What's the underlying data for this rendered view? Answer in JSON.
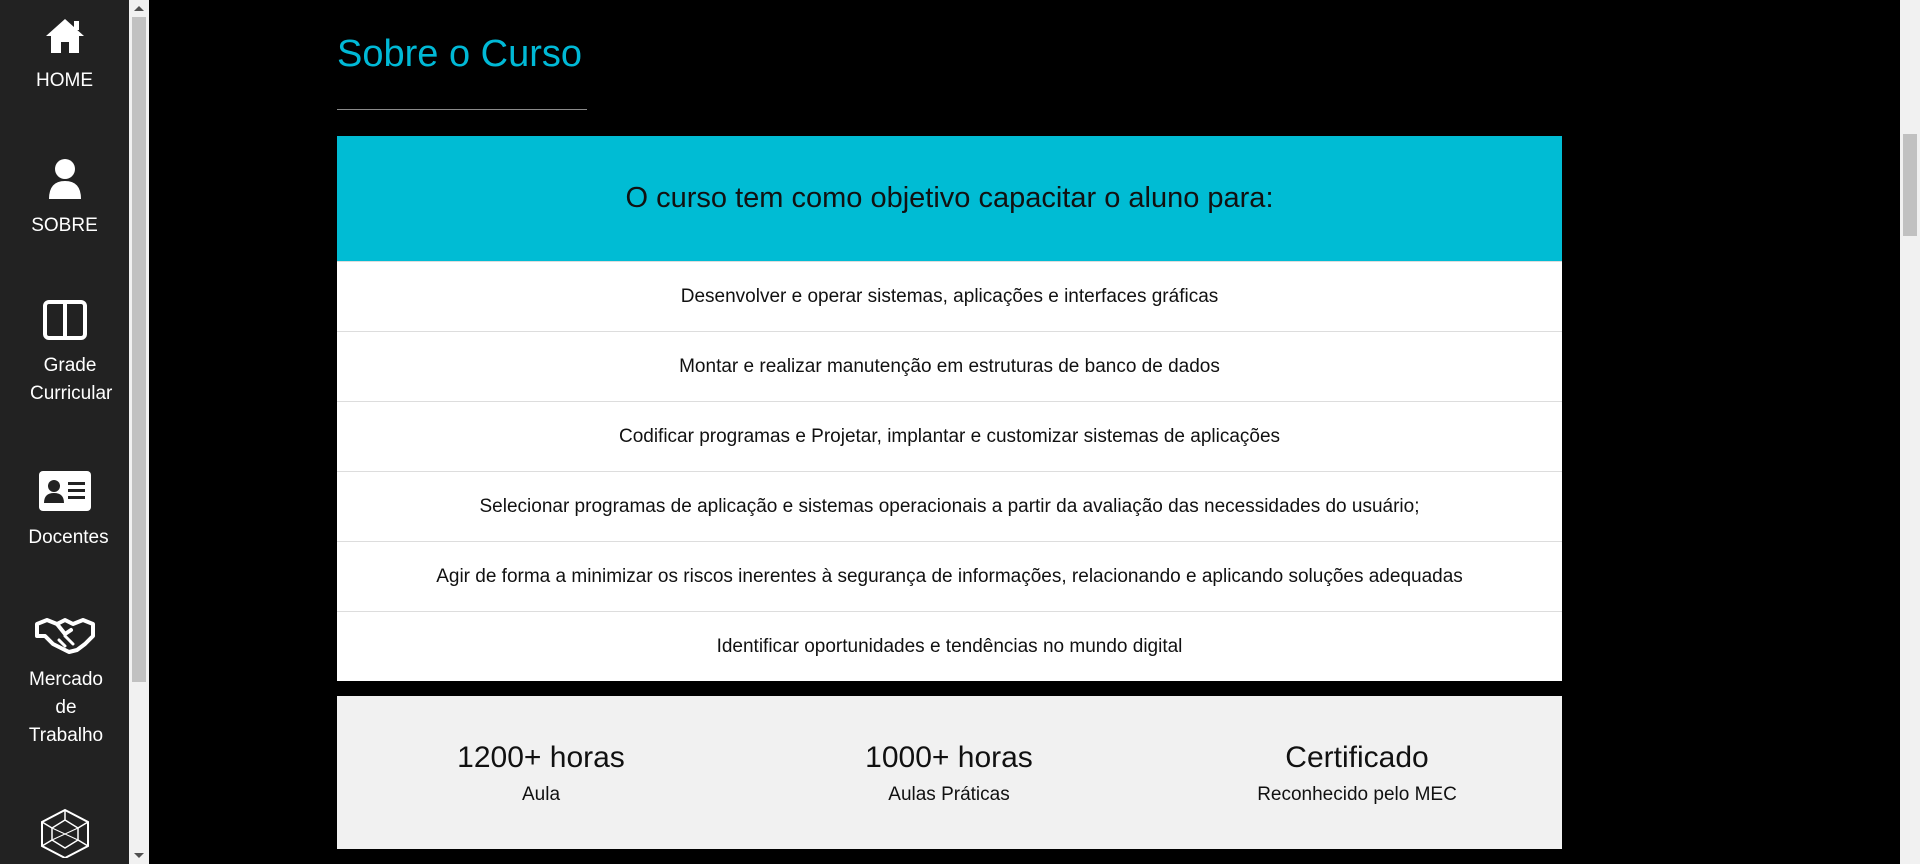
{
  "sidebar": {
    "items": [
      {
        "icon": "home-icon",
        "label": "HOME"
      },
      {
        "icon": "user-icon",
        "label": "SOBRE"
      },
      {
        "icon": "columns-icon",
        "label": "Grade Curricular"
      },
      {
        "icon": "id-card-icon",
        "label": "Docentes"
      },
      {
        "icon": "handshake-icon",
        "label": "Mercado de Trabalho"
      },
      {
        "icon": "polyhedron-icon",
        "label": ""
      }
    ]
  },
  "main": {
    "title": "Sobre o Curso",
    "objectives": {
      "heading": "O curso tem como objetivo capacitar o aluno para:",
      "items": [
        "Desenvolver e operar sistemas, aplicações e interfaces gráficas",
        "Montar e realizar manutenção em estruturas de banco de dados",
        "Codificar programas e Projetar, implantar e customizar sistemas de aplicações",
        "Selecionar programas de aplicação e sistemas operacionais a partir da avaliação das necessidades do usuário;",
        "Agir de forma a minimizar os riscos inerentes à segurança de informações, relacionando e aplicando soluções adequadas",
        "Identificar oportunidades e tendências no mundo digital"
      ]
    },
    "stats": [
      {
        "value": "1200+ horas",
        "label": "Aula"
      },
      {
        "value": "1000+ horas",
        "label": "Aulas Práticas"
      },
      {
        "value": "Certificado",
        "label": "Reconhecido pelo MEC"
      }
    ]
  },
  "colors": {
    "accent": "#00bcd4",
    "title": "#00b9d6",
    "sidebar_bg": "#222222",
    "page_bg": "#000000",
    "stats_bg": "#f1f1f1"
  }
}
